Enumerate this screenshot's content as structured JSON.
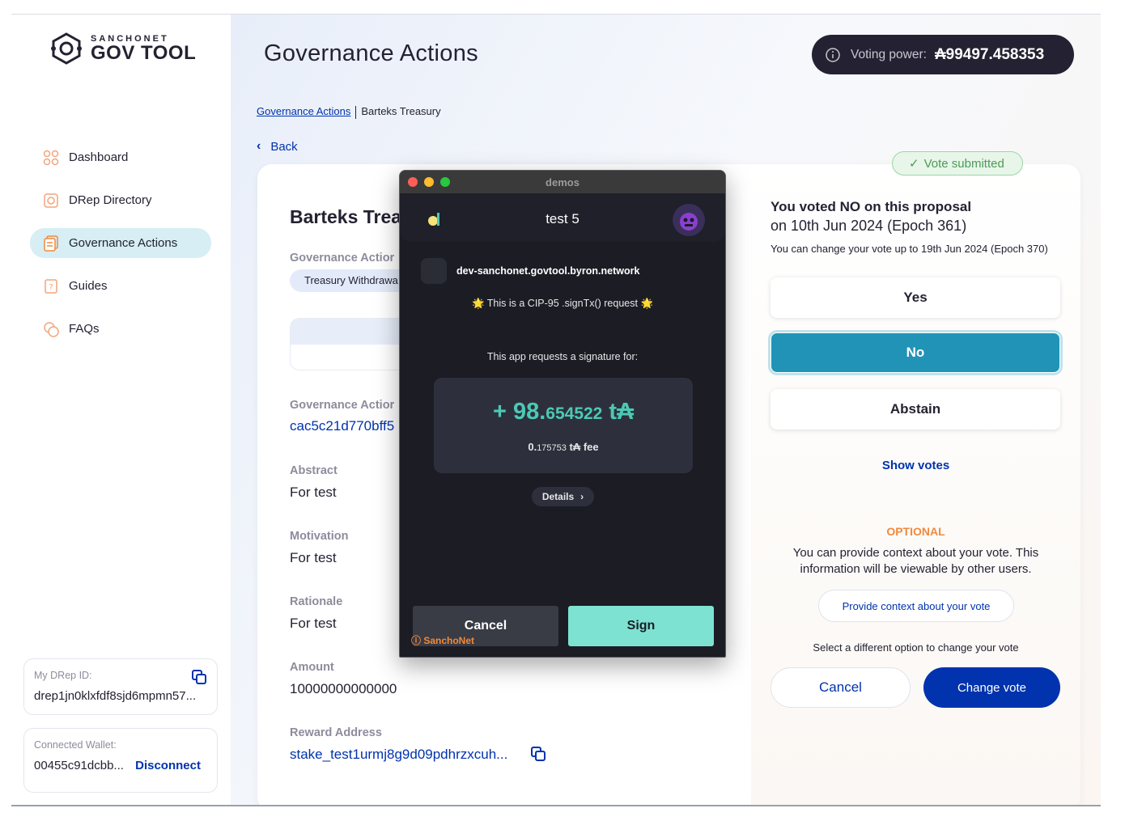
{
  "sidebar": {
    "logo_top": "SANCHONET",
    "logo_bottom": "GOV TOOL",
    "nav": [
      {
        "label": "Dashboard",
        "icon": "dashboard-icon"
      },
      {
        "label": "DRep Directory",
        "icon": "drep-directory-icon"
      },
      {
        "label": "Governance Actions",
        "icon": "governance-actions-icon",
        "active": true
      },
      {
        "label": "Guides",
        "icon": "guides-icon"
      },
      {
        "label": "FAQs",
        "icon": "faqs-icon"
      }
    ],
    "drep_id_label": "My DRep ID:",
    "drep_id_value": "drep1jn0klxfdf8sjd6mpmn57...",
    "wallet_label": "Connected Wallet:",
    "wallet_value": "00455c91dcbb...",
    "disconnect_label": "Disconnect"
  },
  "header": {
    "title": "Governance Actions",
    "voting_power_label": "Voting power:",
    "voting_power_value": "₳99497.458353"
  },
  "breadcrumb": {
    "link": "Governance Actions",
    "current": "Barteks Treasury"
  },
  "back_label": "Back",
  "details": {
    "title": "Barteks Trea",
    "type_label": "Governance Actior",
    "type_chip": "Treasury Withdrawa",
    "id_label": "Governance Actior",
    "id_value": "cac5c21d770bff5",
    "abstract_label": "Abstract",
    "abstract_value": "For test",
    "motivation_label": "Motivation",
    "motivation_value": "For test",
    "rationale_label": "Rationale",
    "rationale_value": "For test",
    "amount_label": "Amount",
    "amount_value": "10000000000000",
    "reward_label": "Reward Address",
    "reward_value": "stake_test1urmj8g9d09pdhrzxcuh..."
  },
  "vote": {
    "badge": "Vote submitted",
    "heading": "You voted NO on this proposal",
    "date": "on 10th Jun 2024 (Epoch 361)",
    "note": "You can change your vote up to 19th Jun 2024 (Epoch 370)",
    "yes": "Yes",
    "no": "No",
    "abstain": "Abstain",
    "selected": "No",
    "show_votes": "Show votes",
    "optional": "OPTIONAL",
    "optional_text": "You can provide context about your vote. This information will be viewable by other users.",
    "context_button": "Provide context about your vote",
    "different_text": "Select a different option to change your vote",
    "cancel": "Cancel",
    "change": "Change vote"
  },
  "wallet_popup": {
    "window_title": "demos",
    "account": "test 5",
    "site": "dev-sanchonet.govtool.byron.network",
    "cip_text": "🌟 This is a CIP-95 .signTx() request 🌟",
    "request_text": "This app requests a signature for:",
    "amount_main": "+ 98.",
    "amount_decimals": "654522",
    "amount_unit": " t₳",
    "fee_value": "0.",
    "fee_decimals": "175753",
    "fee_unit": " t₳  fee",
    "details": "Details",
    "cancel": "Cancel",
    "sign": "Sign",
    "network": "SanchoNet"
  },
  "colors": {
    "primary": "#0033ad",
    "selected_vote": "#2193b6",
    "optional": "#f08a3c",
    "sign_button": "#7de2d1",
    "amount": "#4cc9b5"
  }
}
